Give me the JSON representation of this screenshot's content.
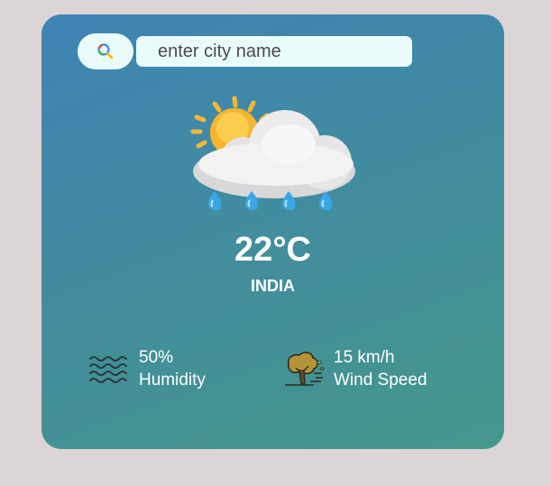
{
  "search": {
    "placeholder": "enter city name",
    "value": "",
    "icon": "search-icon"
  },
  "weather": {
    "icon": "sun-cloud-rain-icon",
    "temperature": "22°C",
    "city": "INDIA"
  },
  "stats": {
    "humidity": {
      "icon": "humidity-waves-icon",
      "value": "50%",
      "label": "Humidity"
    },
    "wind": {
      "icon": "wind-tree-icon",
      "value": "15 km/h",
      "label": "Wind Speed"
    }
  },
  "colors": {
    "page_background": "#dcd5d5",
    "card_gradient_start": "#3f83b4",
    "card_gradient_end": "#45978a",
    "input_background": "#e9fbfb",
    "text": "#ffffff"
  }
}
